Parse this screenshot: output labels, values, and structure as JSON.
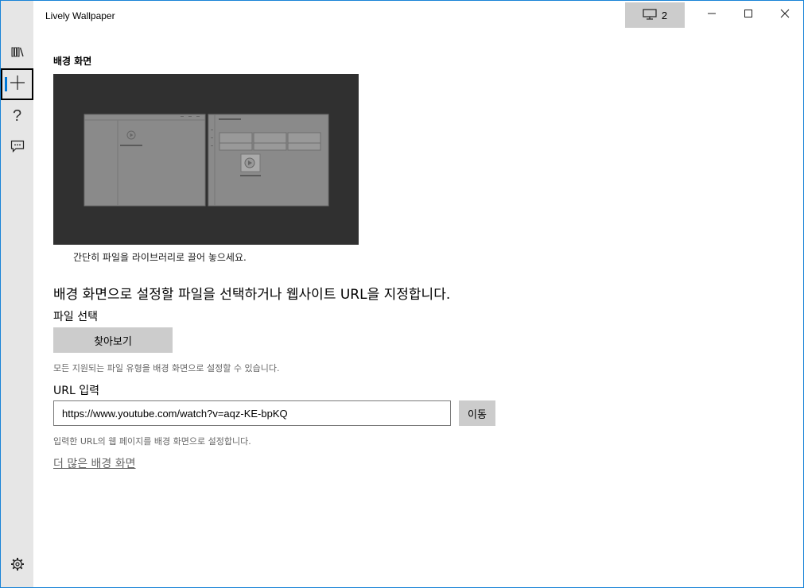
{
  "window": {
    "title": "Lively Wallpaper"
  },
  "titlebar": {
    "monitor_count": "2",
    "minimize_icon": "minimize-icon",
    "maximize_icon": "maximize-icon",
    "close_icon": "close-icon"
  },
  "sidebar": {
    "items": [
      {
        "icon": "library-icon"
      },
      {
        "icon": "add-icon"
      },
      {
        "icon": "help-icon"
      },
      {
        "icon": "feedback-icon"
      },
      {
        "icon": "settings-icon"
      }
    ]
  },
  "main": {
    "section_title": "배경 화면",
    "preview_caption": "간단히 파일을 라이브러리로 끌어 놓으세요.",
    "headline": "배경 화면으로 설정할 파일을 선택하거나 웹사이트 URL을 지정합니다.",
    "file_label": "파일 선택",
    "browse_label": "찾아보기",
    "file_hint": "모든 지원되는 파일 유형을 배경 화면으로 설정할 수 있습니다.",
    "url_label": "URL 입력",
    "url_value": "https://www.youtube.com/watch?v=aqz-KE-bpKQ",
    "go_label": "이동",
    "url_hint": "입력한 URL의 웹 페이지를 배경 화면으로 설정합니다.",
    "more_link": "더 많은 배경 화면"
  },
  "colors": {
    "accent": "#0078d7",
    "sidebar_bg": "#e6e6e6",
    "button_bg": "#cccccc",
    "preview_bg": "#303030"
  }
}
